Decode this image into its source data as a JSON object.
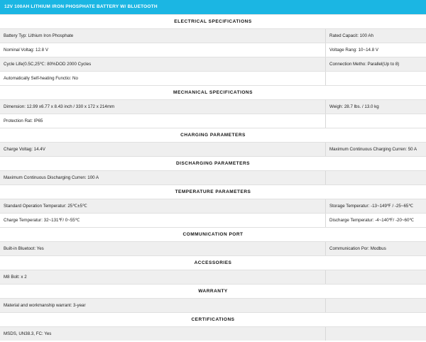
{
  "header": {
    "title": "12V 100AH LITHIUM IRON PHOSPHATE BATTERY W/ BLUETOOTH"
  },
  "sections": [
    {
      "title": "ELECTRICAL SPECIFICATIONS",
      "rows": [
        {
          "left": "Battery Typ: Lithium Iron Phosphate",
          "right": "Rated Capacit: 100 Ah"
        },
        {
          "left": "Nominal Voltag: 12.8 V",
          "right": "Voltage Rang: 10~14.8 V"
        },
        {
          "left": "Cycle Life(0.5C,25℃: 80%DOD 2000 Cycles",
          "right": "Connection Metho: Parallel(Up to 8)"
        },
        {
          "left": "Automatically Self-heating Functio: No",
          "right": ""
        }
      ]
    },
    {
      "title": "MECHANICAL SPECIFICATIONS",
      "rows": [
        {
          "left": "Dimension: 12.99 x6.77 x 8.43 inch / 330 x 172 x 214mm",
          "right": "Weigh: 28.7 lbs. / 13.0 kg"
        },
        {
          "left": "Protection Rat: IP65",
          "right": ""
        }
      ]
    },
    {
      "title": "CHARGING PARAMETERS",
      "rows": [
        {
          "left": "Charge Voltag: 14.4V",
          "right": "Maximum Continuous Charging Curren: 50 A"
        }
      ]
    },
    {
      "title": "DISCHARGING PARAMETERS",
      "rows": [
        {
          "left": "Maximum Continuous Discharging Curren: 100 A",
          "right": ""
        }
      ]
    },
    {
      "title": "TEMPERATURE PARAMETERS",
      "rows": [
        {
          "left": "Standard Operation Temperatur: 25℃±5℃",
          "right": "Storage Temperatur: -13~149℉ / -25~65℃"
        },
        {
          "left": "Charge Temperatur: 32~131℉/ 0~55℃",
          "right": "Discharge Temperatur: -4~140℉/ -20~60℃"
        }
      ]
    },
    {
      "title": "COMMUNICATION PORT",
      "rows": [
        {
          "left": "Built-in Bluetoot: Yes",
          "right": "Communication Por: Modbus"
        }
      ]
    },
    {
      "title": "ACCESSORIES",
      "rows": [
        {
          "left": "M8 Bolt: x 2",
          "right": ""
        }
      ]
    },
    {
      "title": "WARRANTY",
      "rows": [
        {
          "left": "Material and workmanship warrant: 3-year",
          "right": ""
        }
      ]
    },
    {
      "title": "CERTIFICATIONS",
      "rows": [
        {
          "left": "MSDS, UN38.3, FC: Yes",
          "right": ""
        }
      ]
    }
  ]
}
